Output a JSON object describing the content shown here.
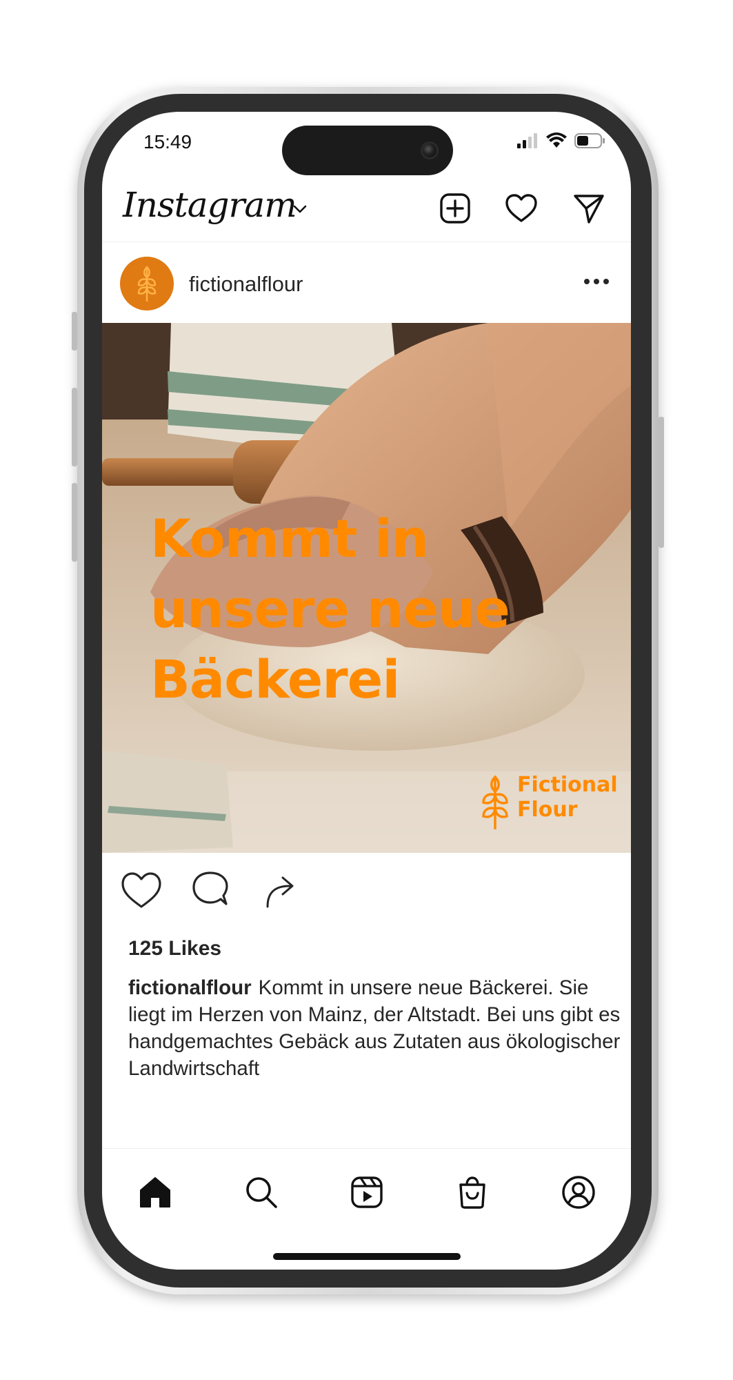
{
  "status_bar": {
    "time": "15:49",
    "icons": [
      "cellular-signal-icon",
      "wifi-icon",
      "battery-icon"
    ]
  },
  "header": {
    "brand": "Instagram",
    "icons": [
      "brand-chevron-down-icon",
      "new-post-icon",
      "notifications-heart-icon",
      "direct-message-icon"
    ]
  },
  "post": {
    "username": "fictionalflour",
    "image": {
      "headline_lines": [
        "Kommt in",
        "unsere neue",
        "Bäckerei"
      ],
      "watermark_lines": [
        "Fictional",
        "Flour"
      ]
    },
    "actions": [
      "like-heart-icon",
      "comment-icon",
      "share-icon"
    ],
    "likes": "125 Likes",
    "caption_user": "fictionalflour",
    "caption_text": "Kommt in unsere neue Bäckerei. Sie liegt im Herzen von Mainz, der Altstadt. Bei uns gibt es handgemachtes Gebäck aus Zutaten aus ökologischer Landwirtschaft"
  },
  "bottom_nav": {
    "items": [
      "home-icon",
      "search-icon",
      "reels-icon",
      "shop-icon",
      "profile-icon"
    ]
  },
  "colors": {
    "accent": "#ff8a00",
    "avatar": "#e07a12",
    "text": "#262626"
  }
}
